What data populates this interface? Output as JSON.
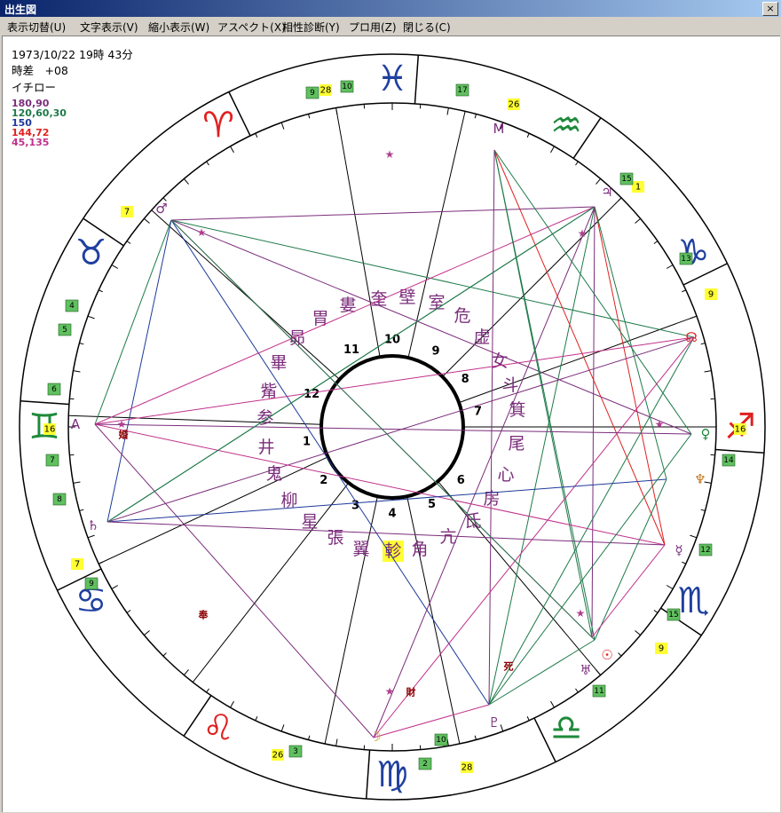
{
  "window": {
    "title": "出生図",
    "close_glyph": "×"
  },
  "menu": [
    {
      "label": "表示切替(U)"
    },
    {
      "label": "文字表示(V)"
    },
    {
      "label": "縮小表示(W)"
    },
    {
      "label": "アスペクト(X)"
    },
    {
      "label": "相性診断(Y)"
    },
    {
      "label": "プロ用(Z)"
    },
    {
      "label": "閉じる(C)"
    }
  ],
  "info": {
    "datetime": "1973/10/22 19時 43分",
    "timediff": "時差　+08",
    "name": "イチロー"
  },
  "legend": [
    {
      "text": "180,90",
      "color": "#7b2d7b"
    },
    {
      "text": "120,60,30",
      "color": "#1e7a4a"
    },
    {
      "text": "150",
      "color": "#1e3a9a"
    },
    {
      "text": "144,72",
      "color": "#e02020"
    },
    {
      "text": "45,135",
      "color": "#c0308a"
    }
  ],
  "signs": [
    {
      "name": "pisces-icon",
      "glyph": "♓",
      "color": "#2040a0"
    },
    {
      "name": "aquarius-icon",
      "glyph": "♒",
      "color": "#1e8a3a"
    },
    {
      "name": "capricorn-icon",
      "glyph": "♑",
      "color": "#2040a0"
    },
    {
      "name": "sagittarius-icon",
      "glyph": "♐",
      "color": "#e02020"
    },
    {
      "name": "scorpio-icon",
      "glyph": "♏",
      "color": "#2040a0"
    },
    {
      "name": "libra-icon",
      "glyph": "♎",
      "color": "#1e8a3a"
    },
    {
      "name": "virgo-icon",
      "glyph": "♍",
      "color": "#2040a0"
    },
    {
      "name": "leo-icon",
      "glyph": "♌",
      "color": "#e02020"
    },
    {
      "name": "cancer-icon",
      "glyph": "♋",
      "color": "#2040a0"
    },
    {
      "name": "gemini-icon",
      "glyph": "♊",
      "color": "#1e8a3a"
    },
    {
      "name": "taurus-icon",
      "glyph": "♉",
      "color": "#2040a0"
    },
    {
      "name": "aries-icon",
      "glyph": "♈",
      "color": "#e02020"
    }
  ],
  "mansions": [
    "奎",
    "壁",
    "室",
    "危",
    "虚",
    "女",
    "斗",
    "箕",
    "尾",
    "心",
    "房",
    "氐",
    "亢",
    "角",
    "軫",
    "翼",
    "張",
    "星",
    "柳",
    "鬼",
    "井",
    "参",
    "觜",
    "畢",
    "昴",
    "胃",
    "婁"
  ],
  "highlighted_mansion": "軫",
  "houses": [
    "1",
    "2",
    "3",
    "4",
    "5",
    "6",
    "7",
    "8",
    "9",
    "10",
    "11",
    "12"
  ],
  "degree_tags": {
    "yellow": [
      "16",
      "16",
      "7",
      "28",
      "26",
      "1",
      "9",
      "7",
      "9",
      "26",
      "28"
    ],
    "green": [
      "9",
      "10",
      "17",
      "15",
      "13",
      "14",
      "15",
      "12",
      "11",
      "10",
      "2",
      "3",
      "4",
      "5",
      "6",
      "7",
      "8",
      "9"
    ]
  },
  "planets": [
    {
      "name": "mars-icon",
      "glyph": "♂",
      "color": "#7b2d7b"
    },
    {
      "name": "jupiter-icon",
      "glyph": "♃",
      "color": "#7b2d7b"
    },
    {
      "name": "midheaven-label",
      "glyph": "M",
      "color": "#7b2d7b"
    },
    {
      "name": "north-node-icon",
      "glyph": "☊",
      "color": "#e02020"
    },
    {
      "name": "venus-icon",
      "glyph": "♀",
      "color": "#1e8a3a"
    },
    {
      "name": "neptune-icon",
      "glyph": "♆",
      "color": "#c07820"
    },
    {
      "name": "mercury-icon",
      "glyph": "☿",
      "color": "#7b2d7b"
    },
    {
      "name": "sun-icon",
      "glyph": "☉",
      "color": "#e02020"
    },
    {
      "name": "uranus-icon",
      "glyph": "♅",
      "color": "#7b2d7b"
    },
    {
      "name": "pluto-icon",
      "glyph": "♇",
      "color": "#7b2d7b"
    },
    {
      "name": "moon-icon",
      "glyph": "☽",
      "color": "#c0a020"
    },
    {
      "name": "saturn-icon",
      "glyph": "♄",
      "color": "#7b2d7b"
    },
    {
      "name": "ascendant-label",
      "glyph": "A",
      "color": "#7b2d7b"
    }
  ],
  "point_labels": [
    "婚",
    "財",
    "死",
    "奉"
  ]
}
